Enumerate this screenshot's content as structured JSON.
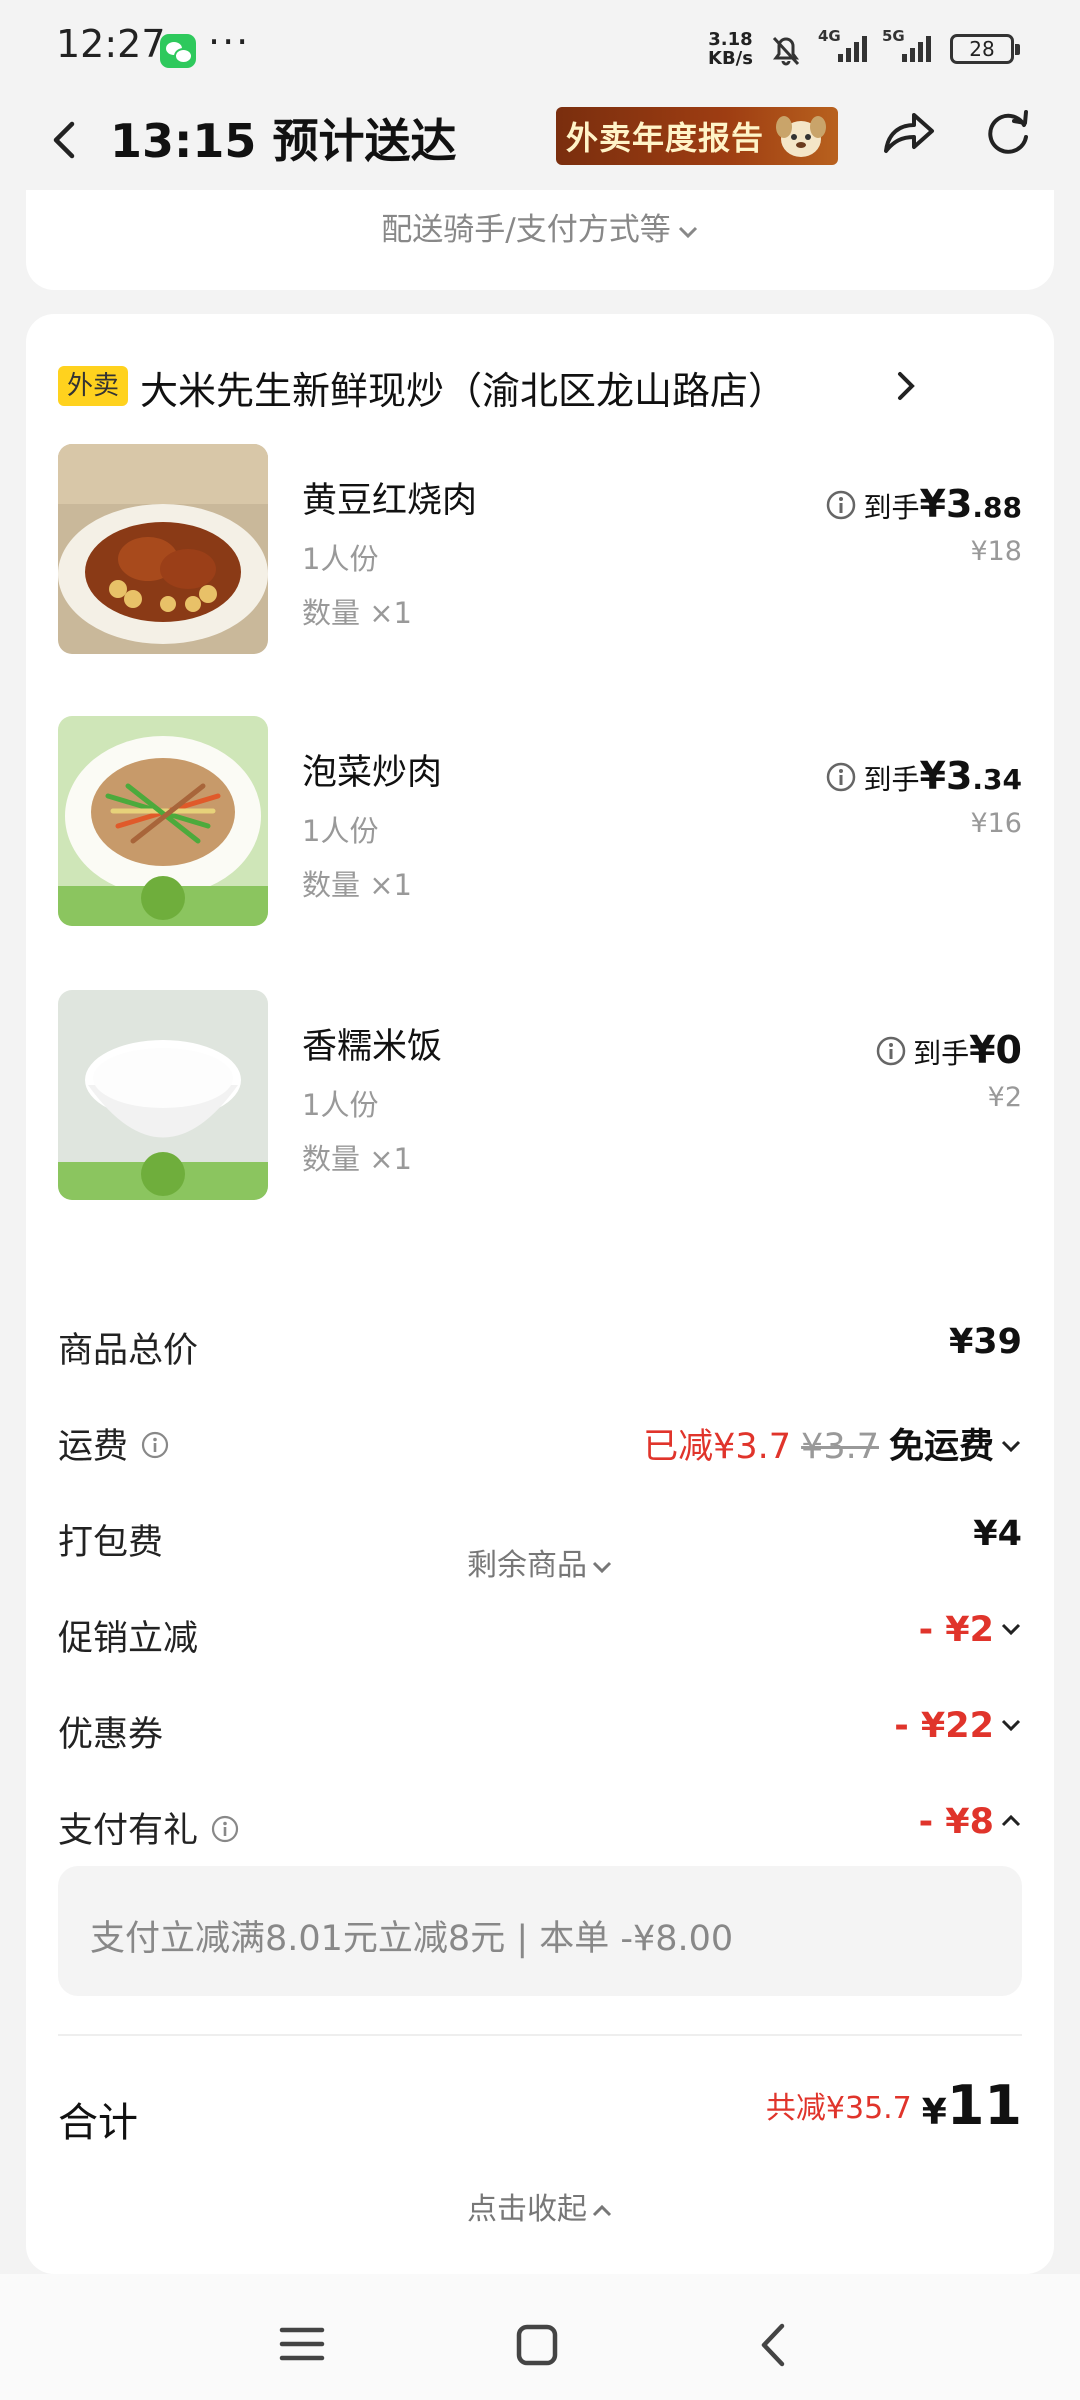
{
  "status_bar": {
    "time": "12:27",
    "dots": "···",
    "net_speed_value": "3.18",
    "net_speed_unit": "KB/s",
    "net1": "4G",
    "net2": "5G",
    "battery": "28"
  },
  "header": {
    "title": "13:15 预计送达",
    "banner_text": "外卖年度报告"
  },
  "top_card": {
    "more_info": "配送骑手/支付方式等"
  },
  "store": {
    "tag": "外卖",
    "name": "大米先生新鲜现炒（渝北区龙山路店）"
  },
  "items": [
    {
      "name": "黄豆红烧肉",
      "portion": "1人份",
      "qty": "数量 ×1",
      "price_prefix": "到手",
      "currency": "¥",
      "price_int": "3",
      "price_dec": ".88",
      "orig": "¥18"
    },
    {
      "name": "泡菜炒肉",
      "portion": "1人份",
      "qty": "数量 ×1",
      "price_prefix": "到手",
      "currency": "¥",
      "price_int": "3",
      "price_dec": ".34",
      "orig": "¥16"
    },
    {
      "name": "香糯米饭",
      "portion": "1人份",
      "qty": "数量 ×1",
      "price_prefix": "到手",
      "currency": "¥",
      "price_int": "0",
      "price_dec": "",
      "orig": "¥2"
    }
  ],
  "remaining_label": "剩余商品",
  "fees": {
    "subtotal": {
      "label": "商品总价",
      "value": "¥39"
    },
    "delivery": {
      "label": "运费",
      "reduced": "已减¥3.7",
      "orig": "¥3.7",
      "value": "免运费"
    },
    "packing": {
      "label": "打包费",
      "value": "¥4"
    },
    "promo": {
      "label": "促销立减",
      "value": "- ¥2"
    },
    "coupon": {
      "label": "优惠券",
      "value": "- ¥22"
    },
    "pay_gift": {
      "label": "支付有礼",
      "value": "- ¥8"
    }
  },
  "pay_detail": "支付立减满8.01元立减8元 | 本单 -¥8.00",
  "total": {
    "label": "合计",
    "saved": "共减¥35.7",
    "currency": "¥",
    "amount": "11"
  },
  "collapse_label": "点击收起",
  "colors": {
    "accent_red": "#e0342b",
    "tag_yellow": "#ffd21e",
    "background": "#f3f3f3"
  }
}
